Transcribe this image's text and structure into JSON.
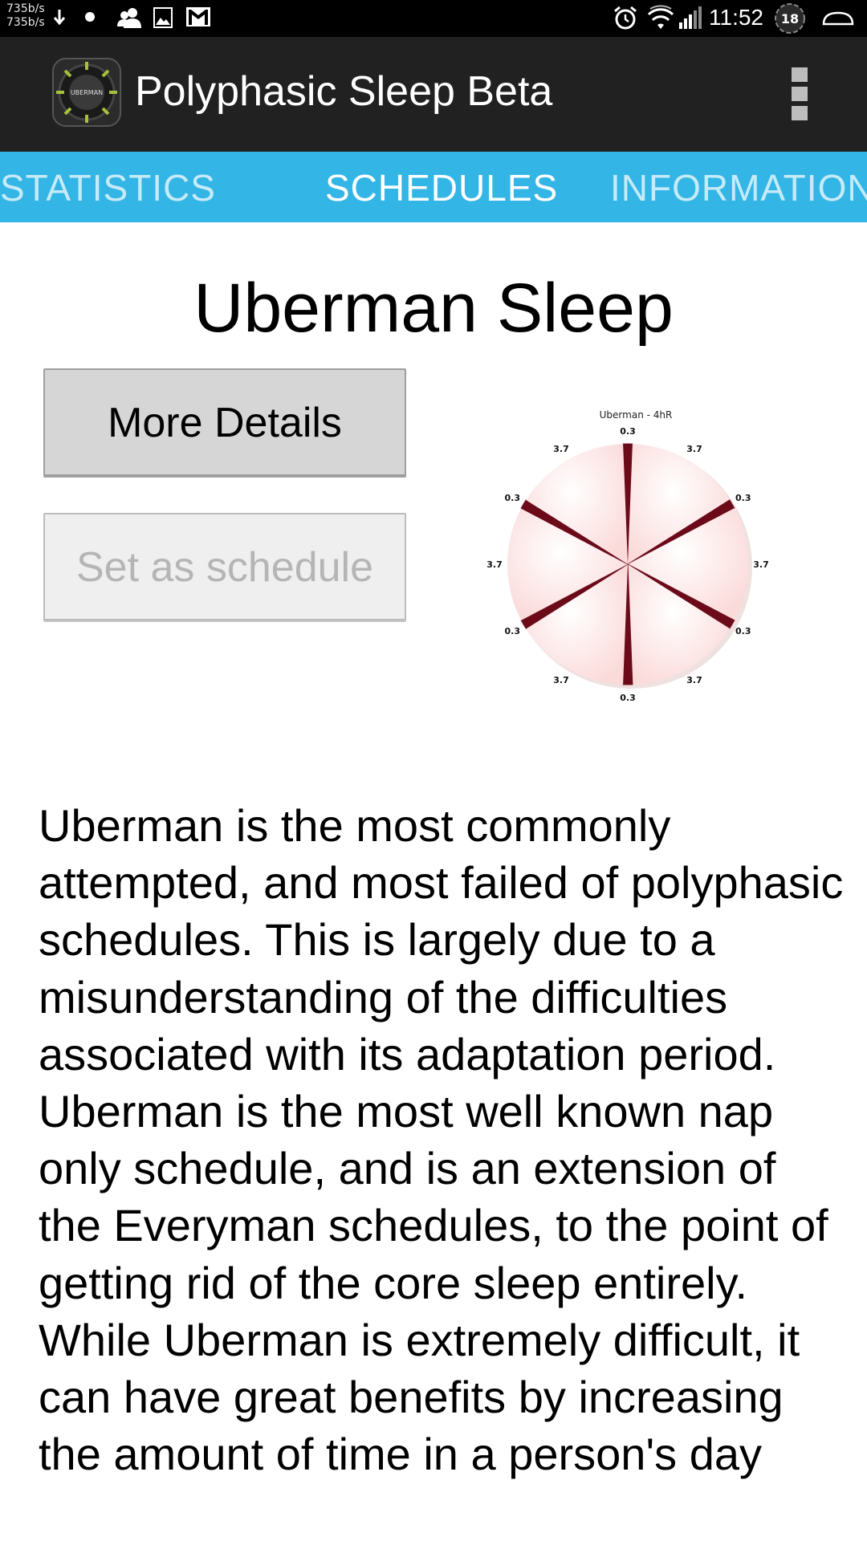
{
  "status_bar": {
    "net_speed_up": "735b/s",
    "net_speed_down": "735b/s",
    "time": "11:52",
    "notification_count": "18",
    "icons": [
      "download-arrow-icon",
      "dot-icon",
      "contacts-icon",
      "image-icon",
      "gmail-icon",
      "alarm-icon",
      "wifi-icon",
      "signal-icon",
      "badge-icon",
      "cloud-icon"
    ]
  },
  "action_bar": {
    "app_title": "Polyphasic Sleep Beta",
    "logo_text": "UBERMAN",
    "overflow_icon": "overflow-menu-icon"
  },
  "tabs": [
    {
      "label": "STATISTICS",
      "active": false
    },
    {
      "label": "SCHEDULES",
      "active": true
    },
    {
      "label": "INFORMATION",
      "active": false
    }
  ],
  "main": {
    "title": "Uberman Sleep",
    "more_details_label": "More Details",
    "set_schedule_label": "Set as schedule",
    "description": "Uberman is the most commonly attempted, and most failed of polyphasic schedules. This is largely due to a misunderstanding of the difficulties associated with its adaptation period. Uberman is the most well known nap only schedule, and is an extension of the Everyman schedules, to the point of getting rid of the core sleep entirely. While Uberman is extremely difficult, it can have great benefits by increasing the amount of time in a person's day"
  },
  "chart_data": {
    "type": "pie",
    "title": "Uberman - 4hR",
    "slices": [
      {
        "label": "0.3",
        "value": 0.3,
        "kind": "sleep"
      },
      {
        "label": "3.7",
        "value": 3.7,
        "kind": "awake"
      },
      {
        "label": "0.3",
        "value": 0.3,
        "kind": "sleep"
      },
      {
        "label": "3.7",
        "value": 3.7,
        "kind": "awake"
      },
      {
        "label": "0.3",
        "value": 0.3,
        "kind": "sleep"
      },
      {
        "label": "3.7",
        "value": 3.7,
        "kind": "awake"
      },
      {
        "label": "0.3",
        "value": 0.3,
        "kind": "sleep"
      },
      {
        "label": "3.7",
        "value": 3.7,
        "kind": "awake"
      },
      {
        "label": "0.3",
        "value": 0.3,
        "kind": "sleep"
      },
      {
        "label": "3.7",
        "value": 3.7,
        "kind": "awake"
      },
      {
        "label": "0.3",
        "value": 0.3,
        "kind": "sleep"
      },
      {
        "label": "3.7",
        "value": 3.7,
        "kind": "awake"
      }
    ],
    "colors": {
      "sleep": "#6b0b1a",
      "awake": "#fdeaea"
    }
  },
  "colors": {
    "status_bar_bg": "#000000",
    "action_bar_bg": "#212121",
    "tab_bar_bg": "#33b5e5",
    "button_bg": "#d6d6d6",
    "button_disabled_bg": "#efefef"
  }
}
